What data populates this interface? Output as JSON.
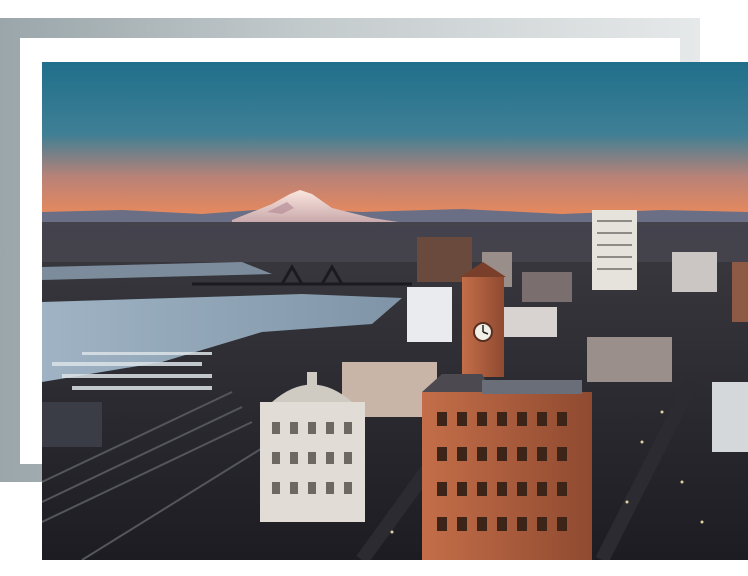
{
  "image": {
    "subject": "",
    "palette": {
      "sky_top": "#1f6f8b",
      "sky_horizon": "#f08a58",
      "water": "#8fa6b8",
      "brick": "#b0603e",
      "mountain_snow": "#f4d6cf",
      "frame_back": "#b7c0c3"
    }
  }
}
